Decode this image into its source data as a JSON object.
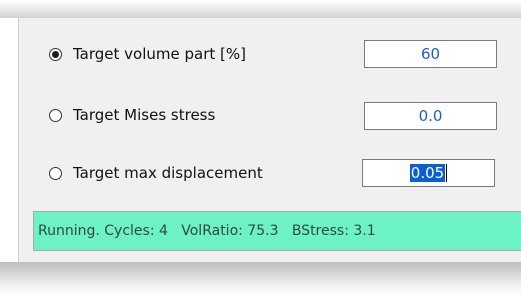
{
  "options": [
    {
      "label": "Target volume part [%]",
      "value": "60",
      "checked": true
    },
    {
      "label": "Target Mises stress",
      "value": "0.0",
      "checked": false
    },
    {
      "label": "Target max displacement",
      "value": "0.05",
      "checked": false
    }
  ],
  "status": {
    "text": "Running. Cycles: 4   VolRatio: 75.3   BStress: 3.1"
  },
  "colors": {
    "panel_bg": "#f0f0f0",
    "status_bg": "#6df2c8",
    "value_text": "#1f5fc4",
    "selection": "#0a5fd6"
  }
}
